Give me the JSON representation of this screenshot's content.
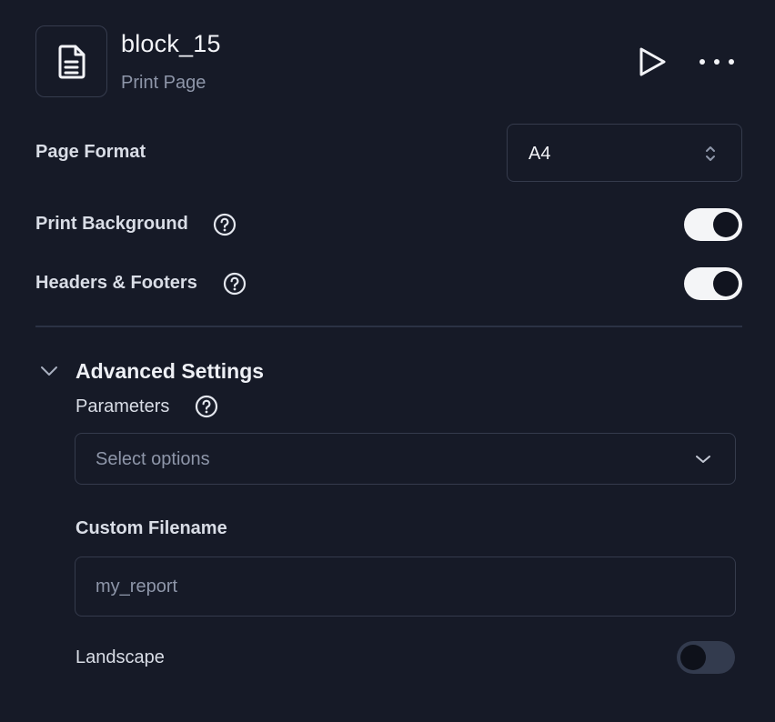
{
  "header": {
    "title": "block_15",
    "subtitle": "Print Page",
    "icon": "document-icon",
    "run_icon": "play-icon",
    "more_icon": "more-horizontal-icon"
  },
  "page_format": {
    "label": "Page Format",
    "selected": "A4"
  },
  "print_background": {
    "label": "Print Background",
    "enabled": true
  },
  "headers_footers": {
    "label": "Headers & Footers",
    "enabled": true
  },
  "advanced": {
    "title": "Advanced Settings",
    "expanded": true,
    "parameters": {
      "label": "Parameters",
      "placeholder": "Select options"
    },
    "custom_filename": {
      "label": "Custom Filename",
      "placeholder": "my_report",
      "value": ""
    },
    "landscape": {
      "label": "Landscape",
      "enabled": false
    }
  },
  "colors": {
    "background": "#161a27",
    "border": "#353b4c",
    "text": "#d9dde6",
    "muted": "#8e96a9",
    "toggle_on": "#f4f5f7",
    "toggle_off": "#333b4e"
  }
}
